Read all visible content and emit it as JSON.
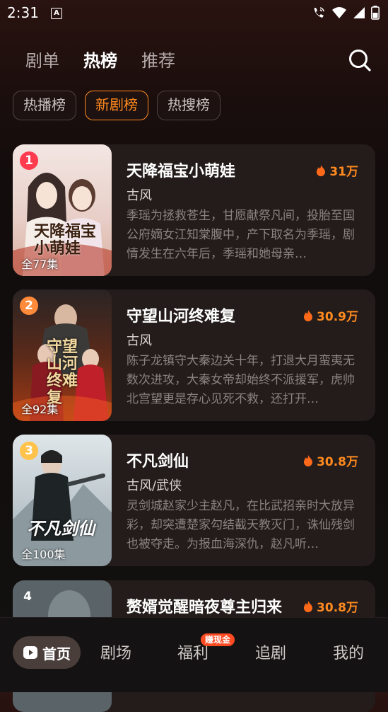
{
  "status": {
    "time": "2:31",
    "a_glyph": "A"
  },
  "top_tabs": [
    "剧单",
    "热榜",
    "推荐"
  ],
  "chips": [
    "热播榜",
    "新剧榜",
    "热搜榜"
  ],
  "dramas": [
    {
      "rank": "1",
      "title": "天降福宝小萌娃",
      "heat": "31万",
      "genre": "古风",
      "episodes": "全77集",
      "description": "季瑶为拯救苍生，甘愿献祭凡间，投胎至国公府嫡女江知棠腹中，产下取名为季瑶，剧情发生在六年后，季瑶和她母亲…",
      "poster_text": "天降福宝小萌娃"
    },
    {
      "rank": "2",
      "title": "守望山河终难复",
      "heat": "30.9万",
      "genre": "古风",
      "episodes": "全92集",
      "description": "陈子龙镇守大秦边关十年，打退大月蛮夷无数次进攻，大秦女帝却始终不派援军，虎帅北宫望更是存心见死不救，还打开…",
      "poster_text": "守望山河终难复"
    },
    {
      "rank": "3",
      "title": "不凡剑仙",
      "heat": "30.8万",
      "genre": "古风/武侠",
      "episodes": "全100集",
      "description": "灵剑城赵家少主赵凡，在比武招亲时大放异彩，却突遭楚家勾结截天教灭门，诛仙残剑也被夺走。为报血海深仇，赵凡听…",
      "poster_text": "不凡剑仙"
    },
    {
      "rank": "4",
      "title": "赘婿觉醒暗夜尊主归来",
      "heat": "30.8万",
      "genre": "",
      "episodes": "",
      "description": ""
    }
  ],
  "bottom_nav": {
    "home": "首页",
    "theater": "剧场",
    "welfare": "福利",
    "welfare_badge": "赚现金",
    "follow": "追剧",
    "mine": "我的"
  }
}
